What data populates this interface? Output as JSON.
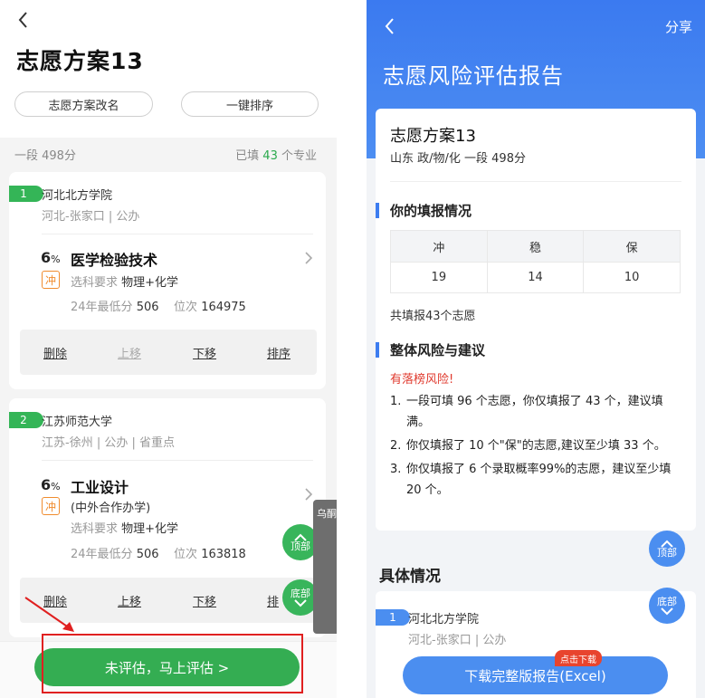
{
  "left": {
    "title": "志愿方案13",
    "rename_button": "志愿方案改名",
    "sort_button": "一键排序",
    "stats": {
      "score": "一段 498分",
      "filled_prefix": "已填",
      "filled_count": "43",
      "filled_suffix": "个专业"
    },
    "cards": [
      {
        "index": "1",
        "school": "河北北方学院",
        "location": "河北-张家口 | 公办",
        "probability": "6",
        "percent": "%",
        "major": "医学检验技术",
        "major_note": "",
        "tag": "冲",
        "req_label": "选科要求",
        "req_value": "物理+化学",
        "min_label": "24年最低分",
        "min_score": "506",
        "rank_label": "位次",
        "rank": "164975",
        "actions": [
          "删除",
          "上移",
          "下移",
          "排序"
        ]
      },
      {
        "index": "2",
        "school": "江苏师范大学",
        "location": "江苏-徐州 | 公办 | 省重点",
        "probability": "6",
        "percent": "%",
        "major": "工业设计",
        "major_note": "(中外合作办学)",
        "tag": "冲",
        "req_label": "选科要求",
        "req_value": "物理+化学",
        "min_label": "24年最低分",
        "min_score": "506",
        "rank_label": "位次",
        "rank": "163818",
        "actions": [
          "删除",
          "上移",
          "下移",
          "排"
        ]
      }
    ],
    "float_top": "顶部",
    "float_bottom": "底部",
    "side_tab": "乌酮",
    "eval_button": "未评估，马上评估 >"
  },
  "right": {
    "share": "分享",
    "title": "志愿风险评估报告",
    "plan_name": "志愿方案13",
    "plan_sub": "山东 政/物/化 一段 498分",
    "section_fill": "你的填报情况",
    "table_headers": [
      "冲",
      "稳",
      "保"
    ],
    "table_values": [
      "19",
      "14",
      "10"
    ],
    "total": "共填报43个志愿",
    "section_risk": "整体风险与建议",
    "risk_warning": "有落榜风险!",
    "advice": [
      {
        "n": "1.",
        "text": "一段可填 96 个志愿，你仅填报了 43 个，建议填满。"
      },
      {
        "n": "2.",
        "text": "你仅填报了 10 个\"保\"的志愿,建议至少填 33 个。"
      },
      {
        "n": "3.",
        "text": "你仅填报了 6 个录取概率99%的志愿，建议至少填 20 个。"
      }
    ],
    "float_top": "顶部",
    "float_bottom": "底部",
    "detail_title": "具体情况",
    "detail_index": "1",
    "detail_school": "河北北方学院",
    "detail_location": "河北-张家口 | 公办",
    "download_tag": "点击下载",
    "download_button": "下载完整版报告(Excel)"
  },
  "colors": {
    "green": "#34ad52",
    "blue": "#4b8ef0",
    "risk_red": "#e03a2e",
    "annotation_red": "#e02020",
    "tag_orange": "#f08c2e"
  }
}
